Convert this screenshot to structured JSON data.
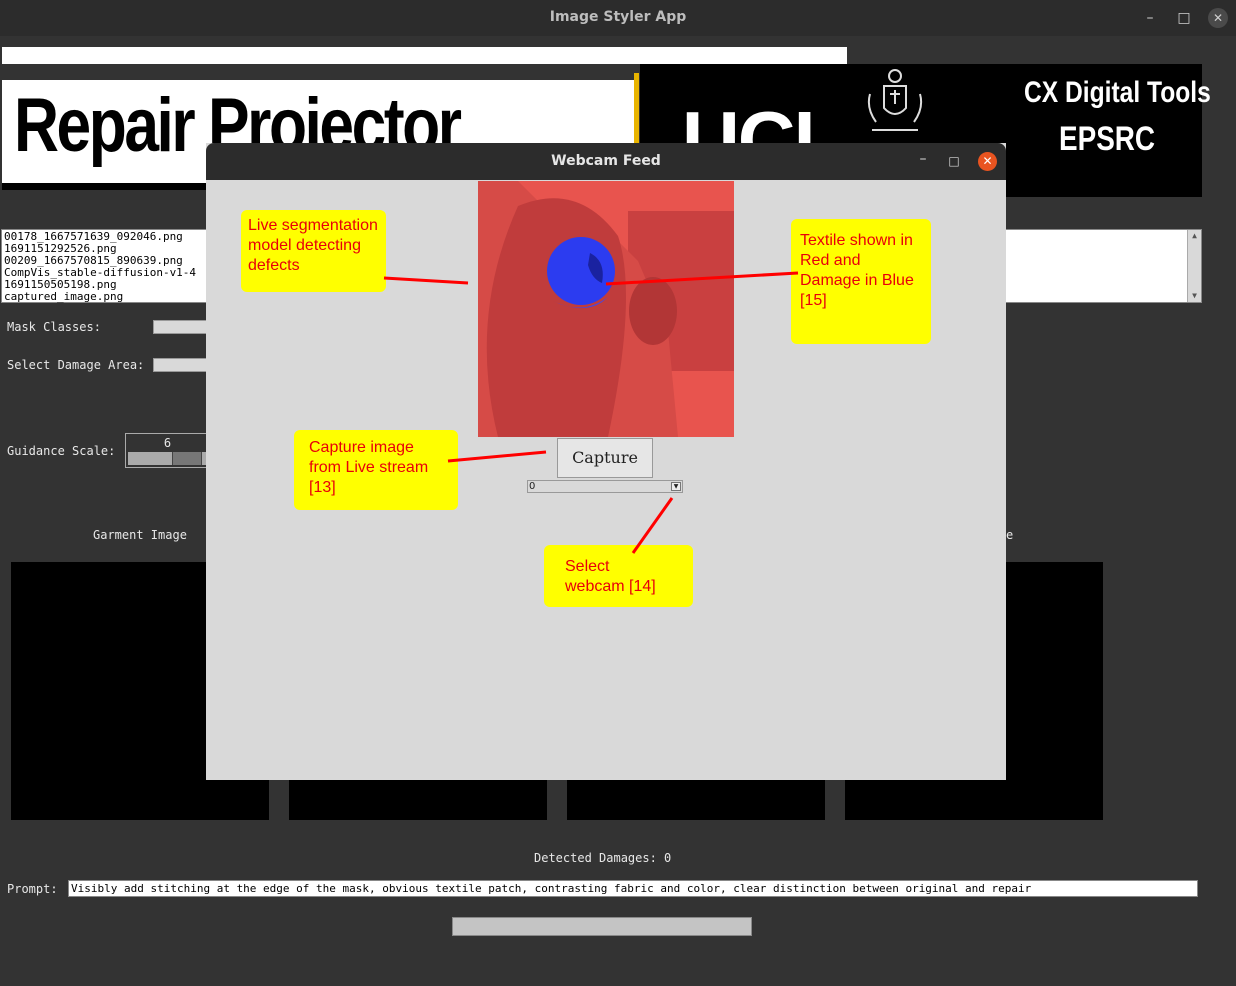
{
  "window": {
    "title": "Image Styler App",
    "minimize_icon": "–",
    "maximize_icon": "□",
    "close_icon": "✕"
  },
  "banner": {
    "title": "Repair Projector",
    "ucl_text": "UCL",
    "right_title": "CX Digital Tools",
    "right_subtitle": "EPSRC"
  },
  "file_list": {
    "items": [
      "00178_1667571639_092046.png",
      "1691151292526.png",
      "00209_1667570815_890639.png",
      "CompVis_stable-diffusion-v1-4",
      "1691150505198.png",
      "captured_image.png"
    ]
  },
  "controls": {
    "mask_classes_label": "Mask Classes:",
    "damage_area_label": "Select Damage Area:",
    "guidance_label": "Guidance Scale:",
    "guidance_value": "6",
    "garment_image_label": "Garment Image",
    "partial_label": "e"
  },
  "webcam_dialog": {
    "title": "Webcam Feed",
    "minimize_icon": "–",
    "maximize_icon": "□",
    "close_icon": "✕",
    "capture_label": "Capture",
    "selected_camera": "0"
  },
  "annotations": {
    "segmentation": "Live segmentation model detecting defects",
    "textile": "Textile shown in Red and Damage in Blue [15]",
    "capture": "Capture image from Live stream [13]",
    "webcam": "Select webcam [14]"
  },
  "bottom": {
    "detected_damages": "Detected Damages: 0",
    "prompt_label": "Prompt:",
    "prompt_value": "Visibly add stitching at the edge of the mask, obvious textile patch, contrasting fabric and color, clear distinction between original and repair"
  },
  "colors": {
    "annotation_bg": "#ffff00",
    "annotation_text": "#e8000a",
    "annotation_line": "#ff0000",
    "textile_overlay": "#e04a4a",
    "damage_overlay": "#2c3cf0",
    "close_button": "#e95420"
  }
}
